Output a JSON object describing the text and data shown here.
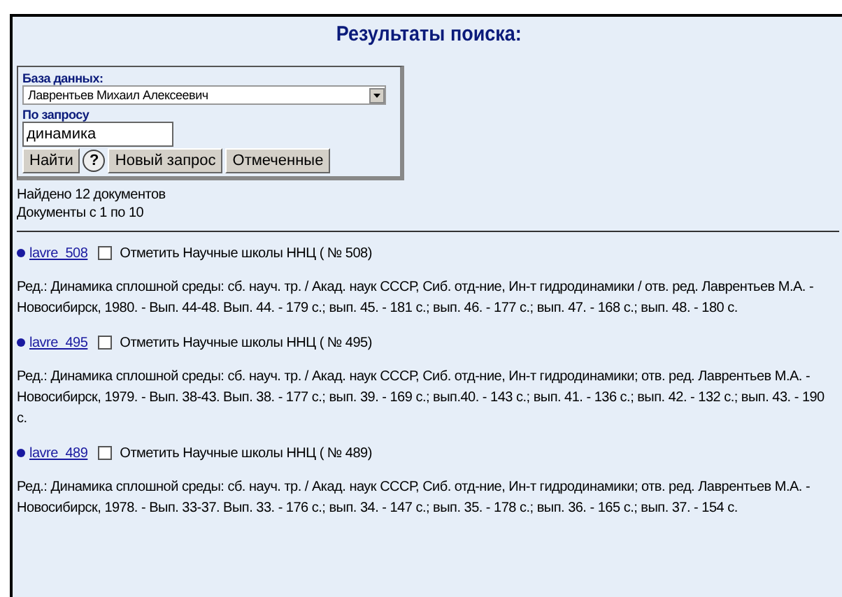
{
  "title": "Результаты поиска:",
  "form": {
    "db_label": "База данных:",
    "db_value": "Лаврентьев Михаил Алексеевич",
    "query_label": "По запросу",
    "query_value": "динамика",
    "buttons": [
      {
        "kind": "text",
        "label": "Найти"
      },
      {
        "kind": "help",
        "label": "?"
      },
      {
        "kind": "text",
        "label": "Новый запрос"
      },
      {
        "kind": "text",
        "label": "Отмеченные"
      }
    ]
  },
  "summary": [
    "Найдено 12 документов",
    "Документы с 1 по 10"
  ],
  "results": [
    {
      "link": "lavre_508",
      "checked": false,
      "mark_label": "Отметить Научные школы ННЦ ( № 508)",
      "citation": "Ред.: Динамика сплошной среды: сб. науч. тр. / Акад. наук СССР, Сиб. отд-ние, Ин-т гидродинамики / отв. ред. Лаврентьев М.А. - Новосибирск, 1980. - Вып. 44-48. Вып. 44. - 179 с.; вып. 45. - 181 с.; вып. 46. - 177 с.; вып. 47. - 168 с.; вып. 48. - 180 с."
    },
    {
      "link": "lavre_495",
      "checked": false,
      "mark_label": "Отметить Научные школы ННЦ ( № 495)",
      "citation": "Ред.: Динамика сплошной среды: сб. науч. тр. / Акад. наук СССР, Сиб. отд-ние, Ин-т гидродинамики; отв. ред. Лаврентьев М.А. - Новосибирск, 1979. - Вып. 38-43. Вып. 38. - 177 с.; вып. 39. - 169 с.; вып.40. - 143 с.; вып. 41. - 136 с.; вып. 42. - 132 с.; вып. 43. - 190 с."
    },
    {
      "link": "lavre_489",
      "checked": false,
      "mark_label": "Отметить Научные школы ННЦ ( № 489)",
      "citation": "Ред.: Динамика сплошной среды: сб. науч. тр. / Акад. наук СССР, Сиб. отд-ние, Ин-т гидродинамики; отв. ред. Лаврентьев М.А. - Новосибирск, 1978. - Вып. 33-37. Вып. 33. - 176 с.; вып. 34. - 147 с.; вып. 35. - 178 с.; вып. 36. - 165 с.; вып. 37. - 154 с."
    }
  ]
}
